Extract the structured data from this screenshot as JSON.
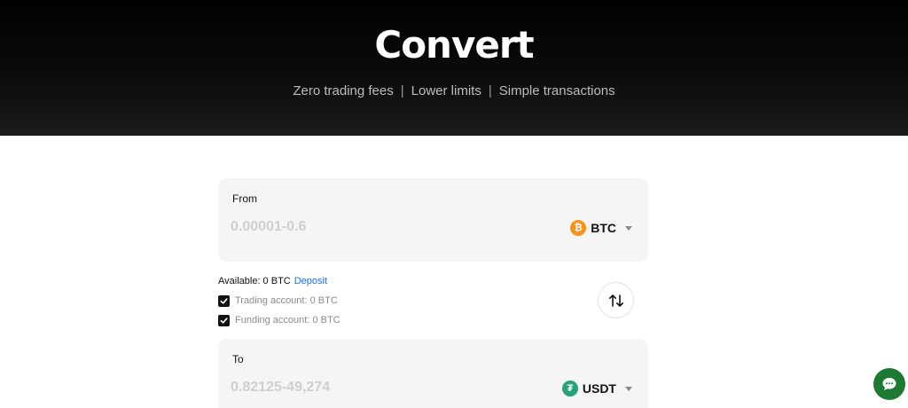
{
  "hero": {
    "title": "Convert",
    "subtitle_items": [
      "Zero trading fees",
      "Lower limits",
      "Simple transactions"
    ],
    "separator": "|"
  },
  "from": {
    "label": "From",
    "placeholder": "0.00001-0.6",
    "coin": "BTC",
    "coin_icon": "bitcoin-icon",
    "coin_color": "#f7931a"
  },
  "balance": {
    "available_text": "Available: 0 BTC",
    "deposit_label": "Deposit",
    "trading_account": "Trading account: 0 BTC",
    "funding_account": "Funding account: 0 BTC",
    "trading_checked": true,
    "funding_checked": true
  },
  "to": {
    "label": "To",
    "placeholder": "0.82125-49,274",
    "coin": "USDT",
    "coin_icon": "tether-icon",
    "coin_color": "#26a17b"
  },
  "colors": {
    "link": "#1f6fe5",
    "chat_button": "#1e7a33"
  },
  "icons": {
    "swap": "swap-arrows-icon",
    "chat": "chat-bubble-icon",
    "dropdown": "chevron-down-icon",
    "check": "check-icon"
  }
}
